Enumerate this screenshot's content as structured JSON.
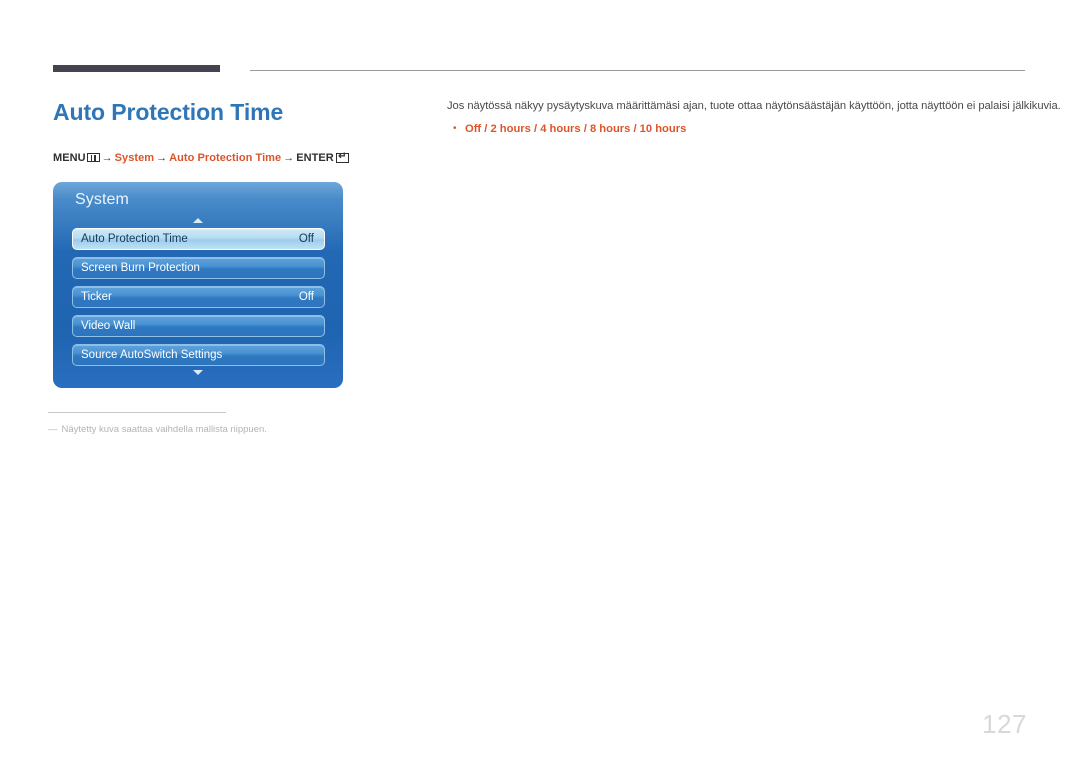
{
  "page": {
    "title": "Auto Protection Time",
    "number": "127"
  },
  "menu_path": {
    "menu_label": "MENU",
    "menu_icon": "menu-bars-icon",
    "arrow": "→",
    "segments": [
      "System",
      "Auto Protection Time"
    ],
    "enter_label": "ENTER",
    "enter_icon": "enter-key-icon",
    "enter_glyph": "↵"
  },
  "osd": {
    "title": "System",
    "scroll_up_icon": "triangle-up-icon",
    "scroll_down_icon": "triangle-down-icon",
    "items": [
      {
        "label": "Auto Protection Time",
        "value": "Off",
        "selected": true
      },
      {
        "label": "Screen Burn Protection",
        "value": "",
        "selected": false
      },
      {
        "label": "Ticker",
        "value": "Off",
        "selected": false
      },
      {
        "label": "Video Wall",
        "value": "",
        "selected": false
      },
      {
        "label": "Source AutoSwitch Settings",
        "value": "",
        "selected": false
      }
    ]
  },
  "description": {
    "paragraph": "Jos näytössä näkyy pysäytyskuva määrittämäsi ajan, tuote ottaa näytönsäästäjän käyttöön, jotta näyttöön ei palaisi jälkikuvia.",
    "bullet_marker": "•",
    "bullet_text": "Off / 2 hours / 4 hours / 8 hours / 10 hours"
  },
  "footnote": {
    "dash": "―",
    "text": "Näytetty kuva saattaa vaihdella mallista riippuen."
  },
  "colors": {
    "title_blue": "#2e76b7",
    "accent_orange": "#dc552a",
    "rule_dark": "#454350",
    "page_number_gray": "#d8d8d8"
  }
}
